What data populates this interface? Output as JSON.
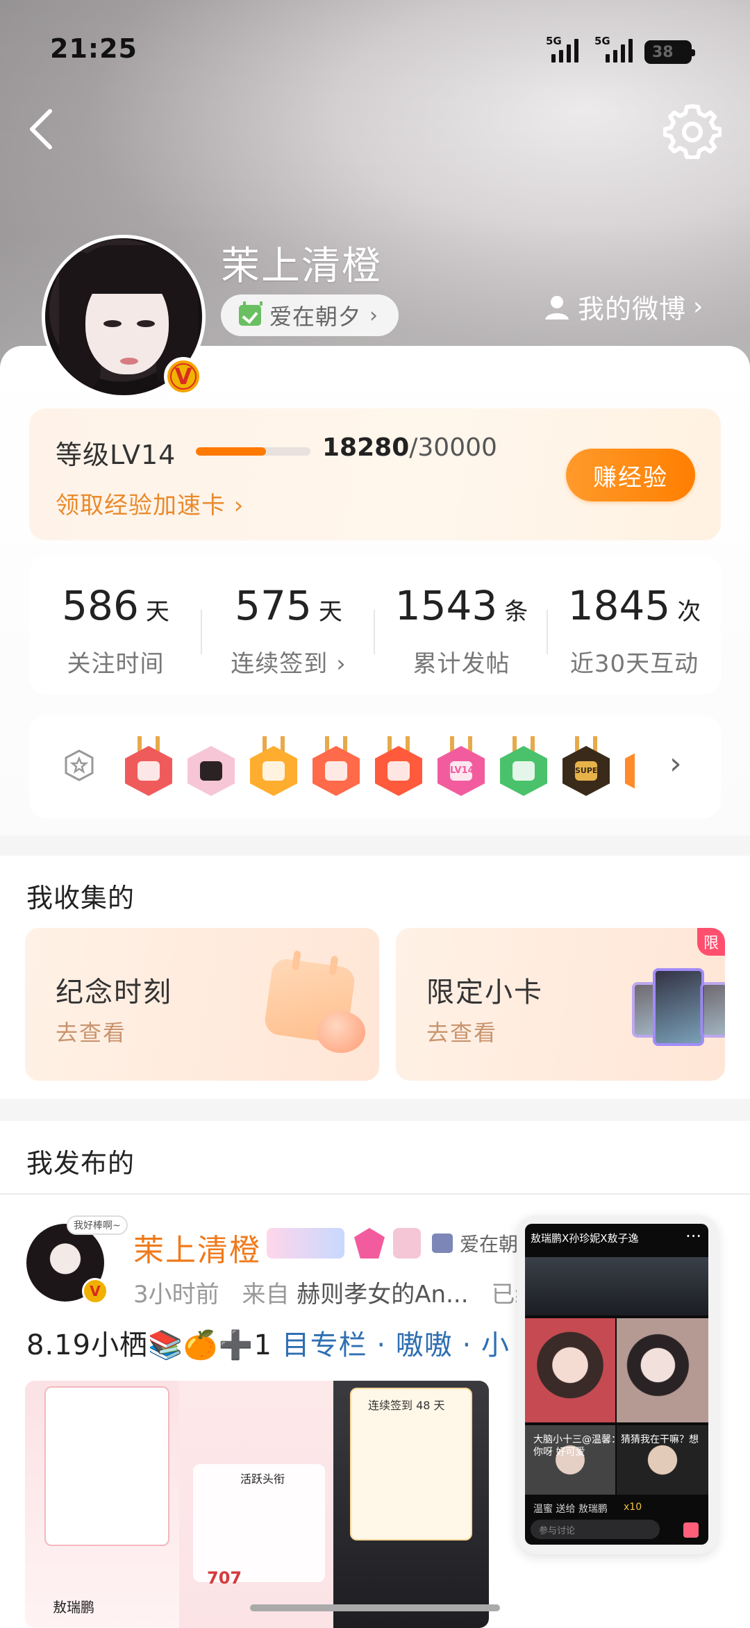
{
  "status_bar": {
    "time": "21:25",
    "signal1_label": "5G",
    "signal2_label": "5G",
    "battery": "38"
  },
  "profile": {
    "username": "茉上清橙",
    "tag_label": "爱在朝夕",
    "tag_arrow": "›",
    "my_weibo_label": "我的微博",
    "my_weibo_arrow": "›",
    "verified_mark": "V"
  },
  "level": {
    "label": "等级LV14",
    "progress": 0.6093,
    "current": "18280",
    "total": "/30000",
    "speed_card_label": "领取经验加速卡 ›",
    "earn_button": "赚经验"
  },
  "stats": [
    {
      "value": "586",
      "unit": "天",
      "label": "关注时间"
    },
    {
      "value": "575",
      "unit": "天",
      "label": "连续签到 ›"
    },
    {
      "value": "1543",
      "unit": "条",
      "label": "累计发帖"
    },
    {
      "value": "1845",
      "unit": "次",
      "label": "近30天互动"
    }
  ],
  "badges": {
    "more_arrow": "›",
    "colors": [
      "#ef5b5b",
      "#f4a3c4",
      "#ffad2e",
      "#ff7a3d",
      "#ff6a4a",
      "#f25c9e",
      "#4ac26b",
      "#3a2a1a"
    ],
    "label_lv": "LV14",
    "label_super": "SUPER"
  },
  "collect": {
    "title": "我收集的",
    "cards": [
      {
        "title": "纪念时刻",
        "sub": "去查看"
      },
      {
        "title": "限定小卡",
        "sub": "去查看",
        "corner": "限"
      }
    ]
  },
  "posted": {
    "title": "我发布的",
    "post": {
      "author": "茉上清橙",
      "bubble": "我好棒啊~",
      "tag": "爱在朝夕",
      "time": "3小时前",
      "from_prefix": "来自",
      "source": "赫则孝女的An...",
      "tail": "已编",
      "text_plain": "8.19小栖📚🍊➕1 ",
      "text_link": "目专栏 · 嗷嗷 · 小",
      "thumb_big_number": "707",
      "thumb_caption_1": "连续签到 48 天",
      "thumb_caption_2": "活跃头衔",
      "thumb_caption_3": "敖瑞鹏"
    }
  },
  "pip": {
    "title": "敖瑞鹏X孙珍妮X敖子逸",
    "more": "···",
    "caption": "大脑小十三@温馨：猜猜我在干嘛？想你呀 好可爱",
    "foot_left": "温蜜 送给 敖瑞鹏",
    "foot_right": "x10",
    "input_placeholder": "参与讨论"
  }
}
